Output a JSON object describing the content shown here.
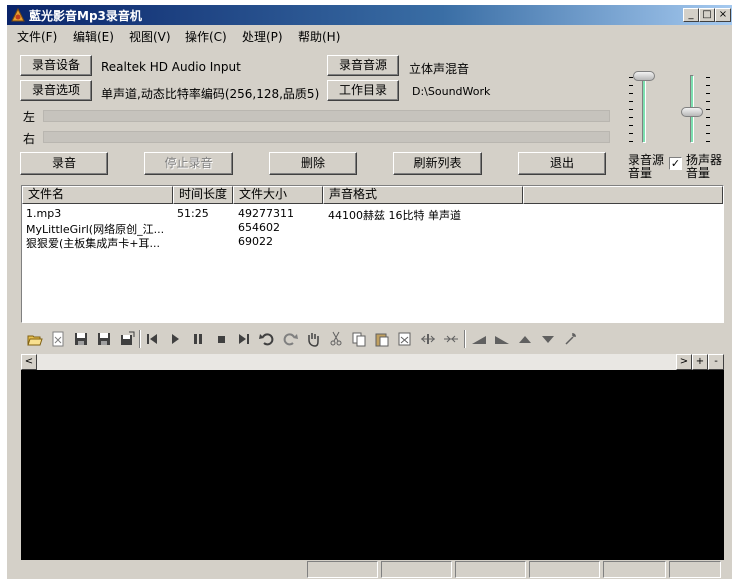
{
  "window": {
    "title": "藍光影音Mp3录音机",
    "minimize": "_",
    "maximize": "□",
    "close": "×"
  },
  "menu": [
    "文件(F)",
    "编辑(E)",
    "视图(V)",
    "操作(C)",
    "处理(P)",
    "帮助(H)"
  ],
  "settings": {
    "device_btn": "录音设备",
    "device_value": "Realtek HD Audio Input",
    "options_btn": "录音选项",
    "options_value": "单声道,动态比特率编码(256,128,品质5)",
    "source_btn": "录音音源",
    "source_value": "立体声混音",
    "dir_btn": "工作目录",
    "dir_value": "D:\\SoundWork"
  },
  "levels": {
    "left_label": "左",
    "right_label": "右",
    "left_level": 0,
    "right_level": 0
  },
  "actions": {
    "record": "录音",
    "stop": "停止录音",
    "delete": "删除",
    "refresh": "刷新列表",
    "exit": "退出"
  },
  "volume": {
    "source_label_1": "录音源",
    "source_label_2": "音量",
    "speaker_label_1": "扬声器",
    "speaker_label_2": "音量",
    "speaker_checked": "✓"
  },
  "files": {
    "headers": [
      "文件名",
      "时间长度",
      "文件大小",
      "声音格式"
    ],
    "rows": [
      {
        "name": "1.mp3",
        "length": "51:25",
        "size": "49277311",
        "format": "44100赫兹 16比特 单声道"
      },
      {
        "name": "MyLittleGirl(网络原创_江...",
        "length": "",
        "size": "654602",
        "format": ""
      },
      {
        "name": "狠狠爱(主板集成声卡+耳...",
        "length": "",
        "size": "69022",
        "format": ""
      }
    ]
  },
  "toolbar_icons": [
    "open-icon",
    "close-file-icon",
    "save-icon",
    "save-as-icon",
    "export-icon",
    "skip-start-icon",
    "play-icon",
    "pause-icon",
    "stop-icon",
    "skip-end-icon",
    "undo-icon",
    "redo-icon",
    "hand-icon",
    "cut-icon",
    "copy-icon",
    "paste-icon",
    "mix-paste-icon",
    "insert-silence-icon",
    "trim-icon",
    "fade-in-icon",
    "fade-out-icon",
    "amplify-icon",
    "attenuate-icon",
    "effects-icon"
  ],
  "scroll": {
    "left": "<",
    "right": ">",
    "zoom_in": "+",
    "zoom_out": "-"
  }
}
